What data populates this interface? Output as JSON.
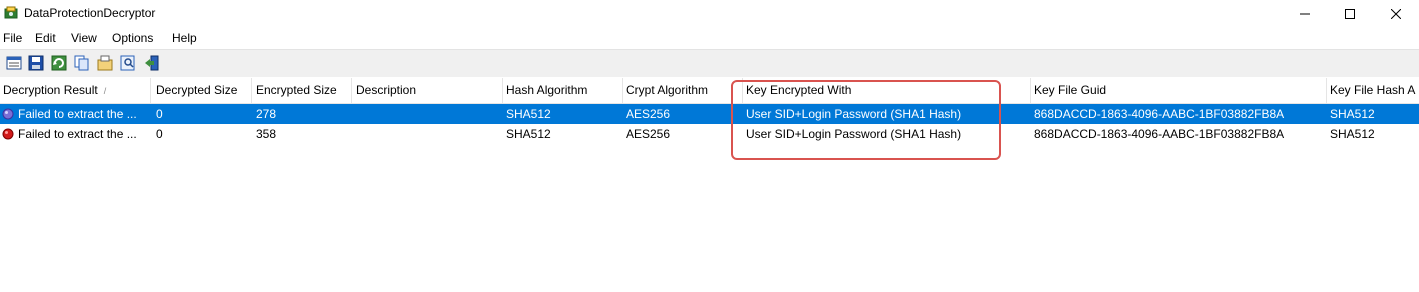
{
  "window": {
    "title": "DataProtectionDecryptor",
    "controls": {
      "minimize": "minimize",
      "maximize": "maximize",
      "close": "close"
    }
  },
  "menu": [
    "File",
    "Edit",
    "View",
    "Options",
    "Help"
  ],
  "toolbar": {
    "icons": [
      "properties-icon",
      "save-icon",
      "refresh-icon",
      "copy-icon",
      "options-icon",
      "find-icon",
      "exit-icon"
    ]
  },
  "table": {
    "columns": [
      "Decryption Result",
      "Decrypted Size",
      "Encrypted Size",
      "Description",
      "Hash Algorithm",
      "Crypt Algorithm",
      "Key Encrypted With",
      "Key File Guid",
      "Key File Hash A"
    ],
    "sort_indicator": "/",
    "rows": [
      {
        "result": "Failed to extract the ...",
        "decrypted_size": "0",
        "encrypted_size": "278",
        "description": "",
        "hash_algorithm": "SHA512",
        "crypt_algorithm": "AES256",
        "key_encrypted_with": "User SID+Login Password (SHA1 Hash)",
        "key_file_guid": "868DACCD-1863-4096-AABC-1BF03882FB8A",
        "key_file_hash": "SHA512",
        "selected": true,
        "status_color": "#7a6fd6"
      },
      {
        "result": "Failed to extract the ...",
        "decrypted_size": "0",
        "encrypted_size": "358",
        "description": "",
        "hash_algorithm": "SHA512",
        "crypt_algorithm": "AES256",
        "key_encrypted_with": "User SID+Login Password (SHA1 Hash)",
        "key_file_guid": "868DACCD-1863-4096-AABC-1BF03882FB8A",
        "key_file_hash": "SHA512",
        "selected": false,
        "status_color": "#d11a1a"
      }
    ]
  },
  "colors": {
    "selection": "#0078d7",
    "highlight_box": "#d9534f"
  }
}
